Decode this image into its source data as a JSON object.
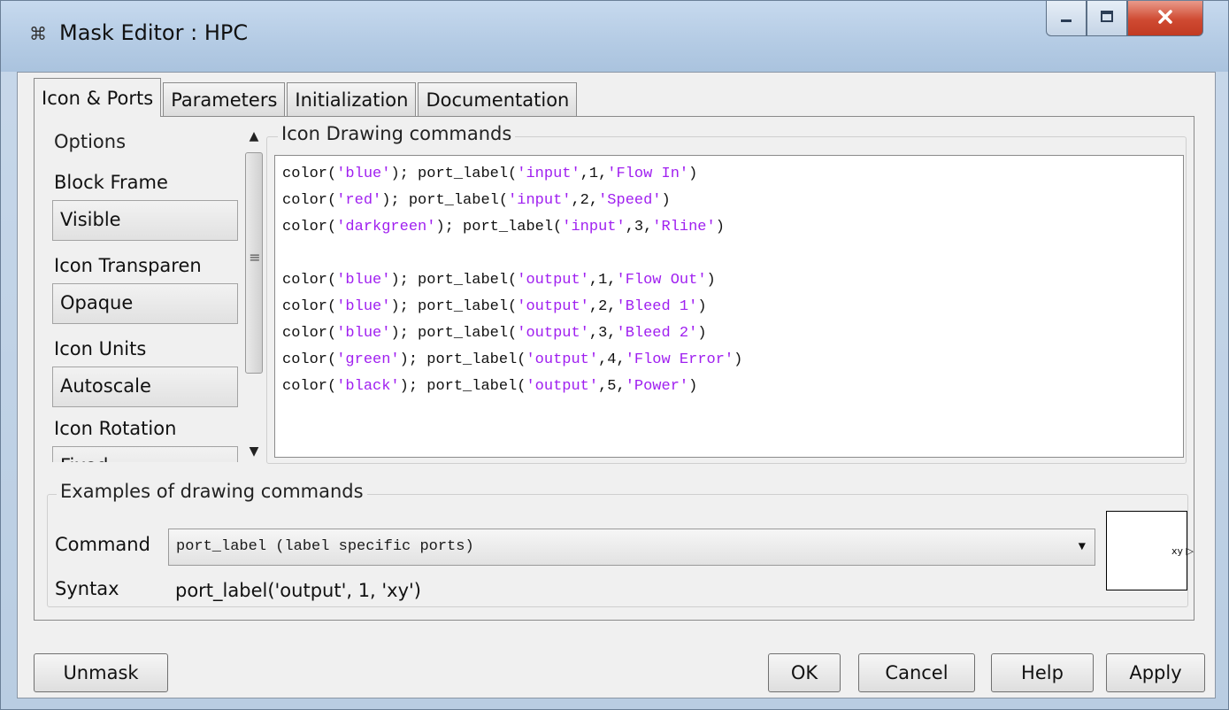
{
  "window": {
    "title": "Mask Editor : HPC",
    "app_icon_glyph": "⌘"
  },
  "tabs": [
    {
      "label": "Icon & Ports",
      "active": true
    },
    {
      "label": "Parameters",
      "active": false
    },
    {
      "label": "Initialization",
      "active": false
    },
    {
      "label": "Documentation",
      "active": false
    }
  ],
  "options": {
    "heading": "Options",
    "block_frame_label": "Block Frame",
    "block_frame_value": "Visible",
    "icon_transparency_label": "Icon Transparen",
    "icon_transparency_value": "Opaque",
    "icon_units_label": "Icon Units",
    "icon_units_value": "Autoscale",
    "icon_rotation_label": "Icon Rotation",
    "icon_rotation_value": "Fixed"
  },
  "drawing_commands": {
    "title": "Icon Drawing commands",
    "lines": [
      [
        {
          "t": "color("
        },
        {
          "t": "'blue'",
          "s": true
        },
        {
          "t": "); port_label("
        },
        {
          "t": "'input'",
          "s": true
        },
        {
          "t": ",1,"
        },
        {
          "t": "'Flow In'",
          "s": true
        },
        {
          "t": ")"
        }
      ],
      [
        {
          "t": "color("
        },
        {
          "t": "'red'",
          "s": true
        },
        {
          "t": "); port_label("
        },
        {
          "t": "'input'",
          "s": true
        },
        {
          "t": ",2,"
        },
        {
          "t": "'Speed'",
          "s": true
        },
        {
          "t": ")"
        }
      ],
      [
        {
          "t": "color("
        },
        {
          "t": "'darkgreen'",
          "s": true
        },
        {
          "t": "); port_label("
        },
        {
          "t": "'input'",
          "s": true
        },
        {
          "t": ",3,"
        },
        {
          "t": "'Rline'",
          "s": true
        },
        {
          "t": ")"
        }
      ],
      [],
      [
        {
          "t": "color("
        },
        {
          "t": "'blue'",
          "s": true
        },
        {
          "t": "); port_label("
        },
        {
          "t": "'output'",
          "s": true
        },
        {
          "t": ",1,"
        },
        {
          "t": "'Flow Out'",
          "s": true
        },
        {
          "t": ")"
        }
      ],
      [
        {
          "t": "color("
        },
        {
          "t": "'blue'",
          "s": true
        },
        {
          "t": "); port_label("
        },
        {
          "t": "'output'",
          "s": true
        },
        {
          "t": ",2,"
        },
        {
          "t": "'Bleed 1'",
          "s": true
        },
        {
          "t": ")"
        }
      ],
      [
        {
          "t": "color("
        },
        {
          "t": "'blue'",
          "s": true
        },
        {
          "t": "); port_label("
        },
        {
          "t": "'output'",
          "s": true
        },
        {
          "t": ",3,"
        },
        {
          "t": "'Bleed 2'",
          "s": true
        },
        {
          "t": ")"
        }
      ],
      [
        {
          "t": "color("
        },
        {
          "t": "'green'",
          "s": true
        },
        {
          "t": "); port_label("
        },
        {
          "t": "'output'",
          "s": true
        },
        {
          "t": ",4,"
        },
        {
          "t": "'Flow Error'",
          "s": true
        },
        {
          "t": ")"
        }
      ],
      [
        {
          "t": "color("
        },
        {
          "t": "'black'",
          "s": true
        },
        {
          "t": "); port_label("
        },
        {
          "t": "'output'",
          "s": true
        },
        {
          "t": ",5,"
        },
        {
          "t": "'Power'",
          "s": true
        },
        {
          "t": ")"
        }
      ]
    ],
    "string_color": "#a020f0"
  },
  "examples": {
    "title": "Examples of drawing commands",
    "command_label": "Command",
    "command_value": "port_label (label specific ports)",
    "syntax_label": "Syntax",
    "syntax_value": "port_label('output', 1, 'xy')",
    "preview_label": "xy"
  },
  "buttons": {
    "unmask": "Unmask",
    "ok": "OK",
    "cancel": "Cancel",
    "help": "Help",
    "apply": "Apply"
  }
}
